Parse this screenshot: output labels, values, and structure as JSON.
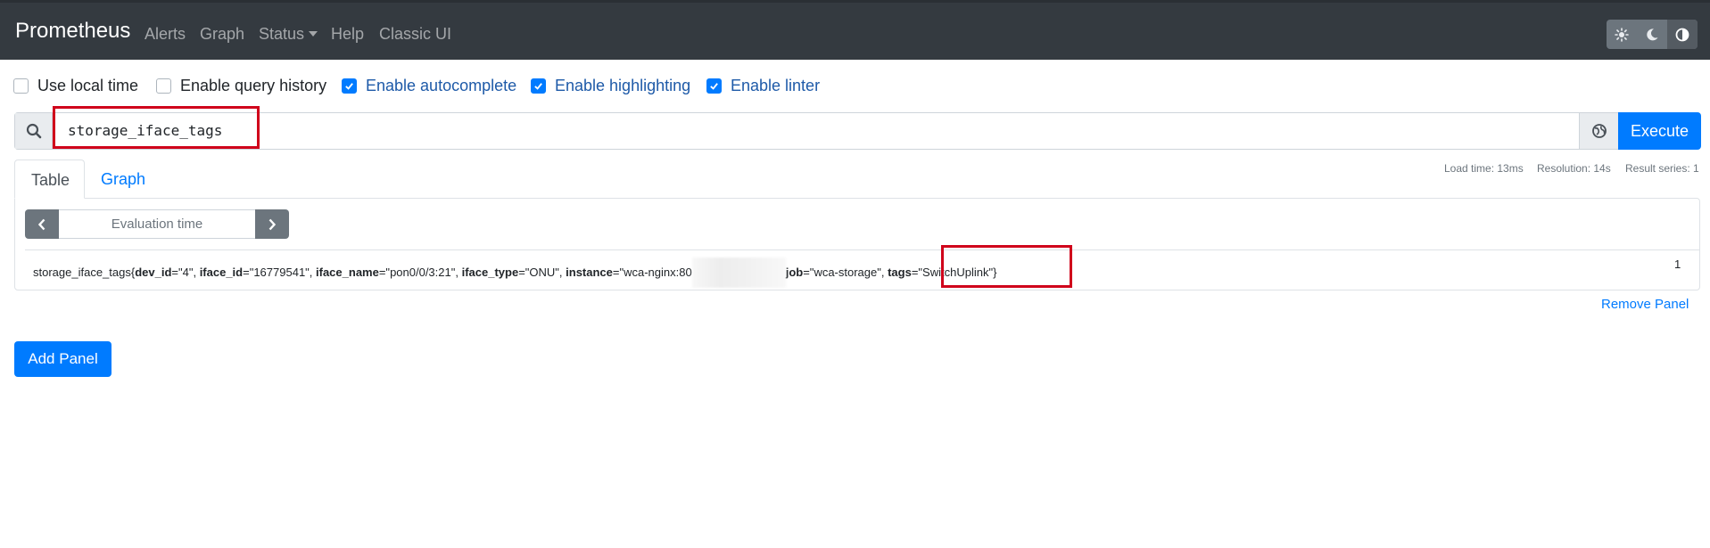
{
  "navbar": {
    "brand": "Prometheus",
    "items": [
      "Alerts",
      "Graph",
      "Status",
      "Help",
      "Classic UI"
    ],
    "theme_icons": [
      "sun-icon",
      "moon-icon",
      "half-circle-icon"
    ]
  },
  "options": [
    {
      "label": "Use local time",
      "checked": false
    },
    {
      "label": "Enable query history",
      "checked": false
    },
    {
      "label": "Enable autocomplete",
      "checked": true
    },
    {
      "label": "Enable highlighting",
      "checked": true
    },
    {
      "label": "Enable linter",
      "checked": true
    }
  ],
  "query": {
    "value": "storage_iface_tags",
    "execute_label": "Execute"
  },
  "tabs": {
    "table": "Table",
    "graph": "Graph"
  },
  "stats": {
    "load_time": "Load time: 13ms",
    "resolution": "Resolution: 14s",
    "result_series": "Result series: 1"
  },
  "evaluation": {
    "placeholder": "Evaluation time"
  },
  "series": {
    "metric": "storage_iface_tags",
    "labels": [
      {
        "key": "dev_id",
        "value": "4"
      },
      {
        "key": "iface_id",
        "value": "16779541"
      },
      {
        "key": "iface_name",
        "value": "pon0/0/3:21"
      },
      {
        "key": "iface_type",
        "value": "ONU"
      },
      {
        "key": "instance",
        "value": "wca-nginx:80"
      },
      {
        "key": "job",
        "value": "wca-storage"
      },
      {
        "key": "tags",
        "value": "SwitchUplink"
      }
    ],
    "value": "1"
  },
  "actions": {
    "remove_panel": "Remove Panel",
    "add_panel": "Add Panel"
  },
  "colors": {
    "navbar_bg": "#343a40",
    "primary": "#007bff",
    "highlight_box": "#d0021b"
  }
}
